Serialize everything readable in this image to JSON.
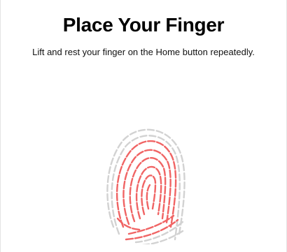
{
  "screen": {
    "title": "Place Your Finger",
    "subtitle": "Lift and rest your finger on the Home button repeatedly."
  },
  "fingerprint": {
    "icon": "fingerprint-icon",
    "captured_color": "#f06464",
    "uncaptured_color": "#d2d2d2"
  }
}
